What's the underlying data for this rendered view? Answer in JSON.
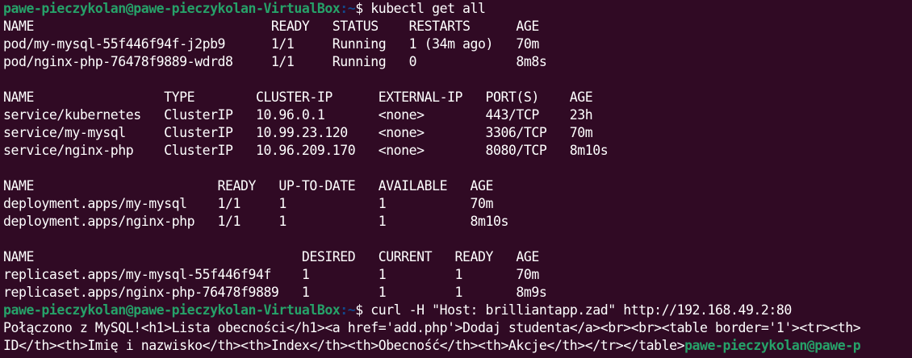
{
  "prompt": {
    "user_host": "pawe-pieczykolan@pawe-pieczykolan-VirtualBox",
    "path": ":~",
    "symbol": "$ "
  },
  "commands": {
    "first": "kubectl get all",
    "second": "curl -H \"Host: brilliantapp.zad\" http://192.168.49.2:80"
  },
  "pods": {
    "header": "NAME                               READY   STATUS    RESTARTS      AGE",
    "rows": [
      "pod/my-mysql-55f446f94f-j2pb9      1/1     Running   1 (34m ago)   70m",
      "pod/nginx-php-76478f9889-wdrd8     1/1     Running   0             8m8s"
    ]
  },
  "services": {
    "header": "NAME                 TYPE        CLUSTER-IP      EXTERNAL-IP   PORT(S)    AGE",
    "rows": [
      "service/kubernetes   ClusterIP   10.96.0.1       <none>        443/TCP    23h",
      "service/my-mysql     ClusterIP   10.99.23.120    <none>        3306/TCP   70m",
      "service/nginx-php    ClusterIP   10.96.209.170   <none>        8080/TCP   8m10s"
    ]
  },
  "deployments": {
    "header": "NAME                        READY   UP-TO-DATE   AVAILABLE   AGE",
    "rows": [
      "deployment.apps/my-mysql    1/1     1            1           70m",
      "deployment.apps/nginx-php   1/1     1            1           8m10s"
    ]
  },
  "replicasets": {
    "header": "NAME                                   DESIRED   CURRENT   READY   AGE",
    "rows": [
      "replicaset.apps/my-mysql-55f446f94f    1         1         1       70m",
      "replicaset.apps/nginx-php-76478f9889   1         1         1       8m9s"
    ]
  },
  "curl_output": {
    "line1": "Połączono z MySQL!<h1>Lista obecności</h1><a href='add.php'>Dodaj studenta</a><br><br><table border='1'><tr><th>",
    "line2": "ID</th><th>Imię i nazwisko</th><th>Index</th><th>Obecność</th><th>Akcje</th></tr></table>",
    "line2_prompt": "pawe-pieczykolan@pawe-p"
  }
}
